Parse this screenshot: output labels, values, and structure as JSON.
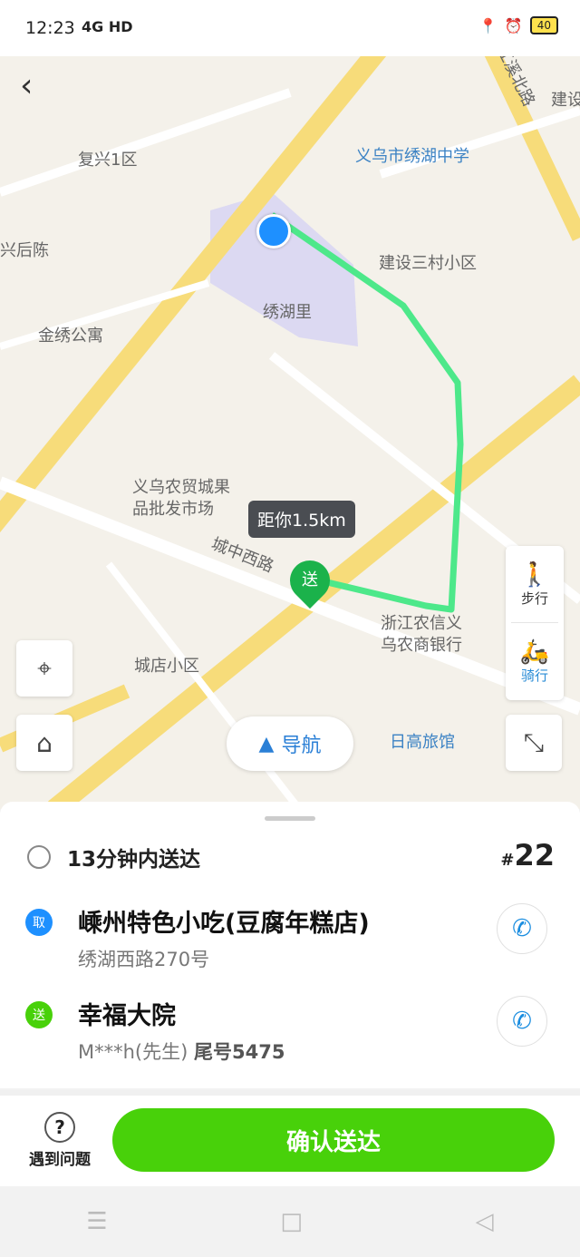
{
  "status": {
    "time": "12:23",
    "network": "4G HD",
    "battery": "40"
  },
  "map": {
    "labels": {
      "fuxing": "复兴1区",
      "school": "义乌市绣湖中学",
      "xinghou": "兴后陈",
      "jianshe": "建设三村小区",
      "xiuhuli": "绣湖里",
      "jinxiu": "金绣公寓",
      "market": "义乌农贸城果\n品批发市场",
      "road": "城中西路",
      "bank": "浙江农信义\n乌农商银行",
      "chengdian": "城店小区",
      "hotel": "日高旅馆",
      "jianxi": "江溪北路",
      "jianse": "建设"
    },
    "distance": "距你1.5km",
    "drop_pin": "送",
    "modes": {
      "walk": "步行",
      "ride": "骑行"
    },
    "navigate": "导航"
  },
  "order": {
    "eta": "13分钟内送达",
    "number_prefix": "#",
    "number": "22",
    "pickup": {
      "badge": "取",
      "name": "嵊州特色小吃(豆腐年糕店)",
      "address": "绣湖西路270号"
    },
    "dropoff": {
      "badge": "送",
      "name": "幸福大院",
      "customer": "M***h(先生)",
      "tail": "尾号5475"
    }
  },
  "actions": {
    "help": "遇到问题",
    "confirm": "确认送达"
  },
  "colors": {
    "accent": "#48d10a",
    "route": "#4de88a",
    "blue": "#2a8cd6"
  }
}
